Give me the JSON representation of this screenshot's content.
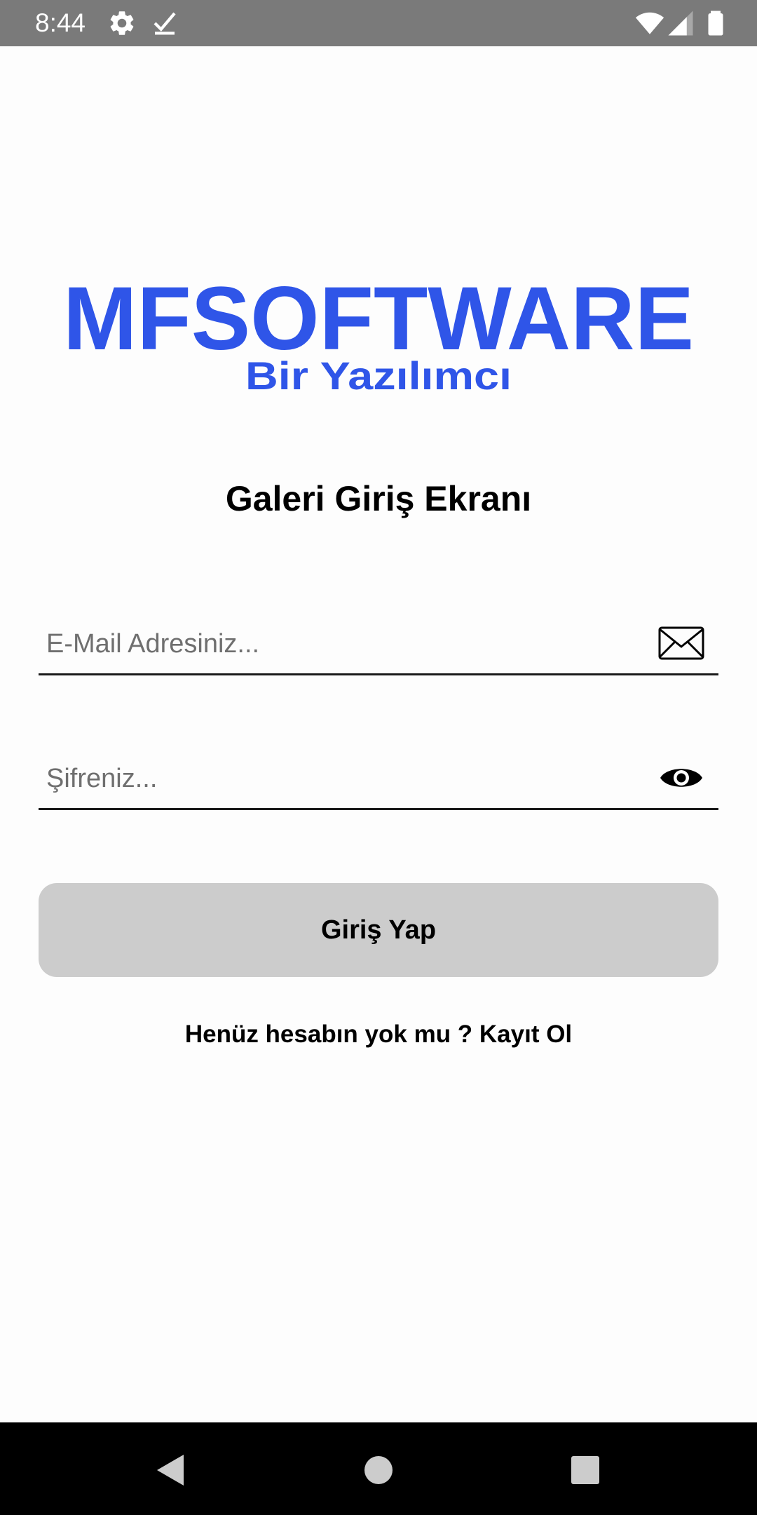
{
  "status_bar": {
    "time": "8:44",
    "icons": [
      "gear-icon",
      "download-done-icon",
      "wifi-icon",
      "signal-icon",
      "battery-icon"
    ]
  },
  "logo": {
    "title": "MFSOFTWARE",
    "subtitle": "Bir Yazılımcı",
    "color": "#2f55e8"
  },
  "screen_title": "Galeri Giriş Ekranı",
  "form": {
    "email": {
      "value": "",
      "placeholder": "E-Mail Adresiniz...",
      "icon": "envelope-icon"
    },
    "password": {
      "value": "",
      "placeholder": "Şifreniz...",
      "icon": "eye-icon"
    },
    "login_label": "Giriş Yap"
  },
  "register_link": "Henüz hesabın yok mu ? Kayıt Ol",
  "nav_bar": {
    "buttons": [
      "back-icon",
      "home-icon",
      "recents-icon"
    ]
  }
}
